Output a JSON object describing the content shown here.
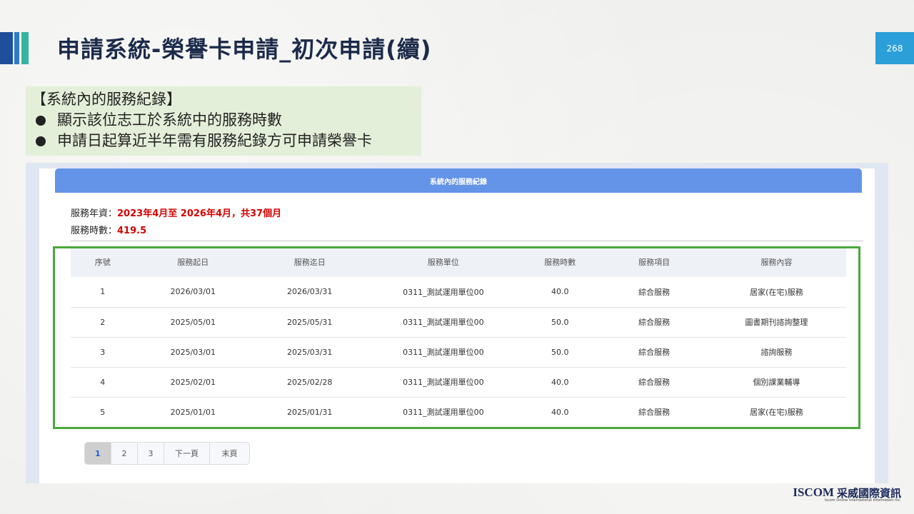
{
  "slide": {
    "title": "申請系統-榮譽卡申請_初次申請(續)",
    "page_number": "268"
  },
  "callout": {
    "heading": "【系統內的服務紀錄】",
    "bullets": [
      "顯示該位志工於系統中的服務時數",
      "申請日起算近半年需有服務紀錄方可申請榮譽卡"
    ]
  },
  "panel": {
    "header": "系統內的服務紀錄",
    "tenure_label": "服務年資：",
    "tenure_value": "2023年4月至 2026年4月，共37個月",
    "hours_label": "服務時數：",
    "hours_value": "419.5"
  },
  "table": {
    "columns": [
      "序號",
      "服務起日",
      "服務迄日",
      "服務單位",
      "服務時數",
      "服務項目",
      "服務內容"
    ],
    "rows": [
      [
        "1",
        "2026/03/01",
        "2026/03/31",
        "0311_測試運用單位00",
        "40.0",
        "綜合服務",
        "居家(在宅)服務"
      ],
      [
        "2",
        "2025/05/01",
        "2025/05/31",
        "0311_測試運用單位00",
        "50.0",
        "綜合服務",
        "圖書期刊諮詢整理"
      ],
      [
        "3",
        "2025/03/01",
        "2025/03/31",
        "0311_測試運用單位00",
        "50.0",
        "綜合服務",
        "諮詢服務"
      ],
      [
        "4",
        "2025/02/01",
        "2025/02/28",
        "0311_測試運用單位00",
        "40.0",
        "綜合服務",
        "個別課業輔導"
      ],
      [
        "5",
        "2025/01/01",
        "2025/01/31",
        "0311_測試運用單位00",
        "40.0",
        "綜合服務",
        "居家(在宅)服務"
      ]
    ]
  },
  "pager": {
    "pages": [
      "1",
      "2",
      "3"
    ],
    "active": "1",
    "next": "下一頁",
    "last": "末頁"
  },
  "logo": {
    "en": "ISCOM",
    "zh": "采威國際資訊",
    "sub": "Iscom Online International Information Inc."
  },
  "colors": {
    "panel_header": "#6494e8",
    "highlight_frame": "#4aa83a",
    "value_red": "#d40000",
    "page_badge": "#2a9fd8",
    "callout_bg": "#e4efd9"
  }
}
